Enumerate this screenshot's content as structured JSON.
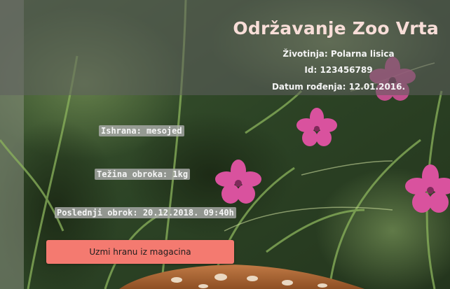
{
  "header": {
    "title": "Održavanje Zoo Vrta",
    "animal_line": "Životinja: Polarna lisica",
    "id_line": "Id: 123456789",
    "dob_line": "Datum rođenja: 12.01.2016."
  },
  "details": {
    "diet": "Ishrana: mesojed",
    "meal_weight": "Težina obroka: 1kg",
    "last_meal": "Poslednji obrok: 20.12.2018. 09:40h"
  },
  "actions": {
    "take_food_label": "Uzmi hranu iz magacina"
  },
  "colors": {
    "button": "#f47a70",
    "title": "#f8ded8",
    "header_overlay": "#5f5f5f",
    "flower": "#d9529e"
  }
}
